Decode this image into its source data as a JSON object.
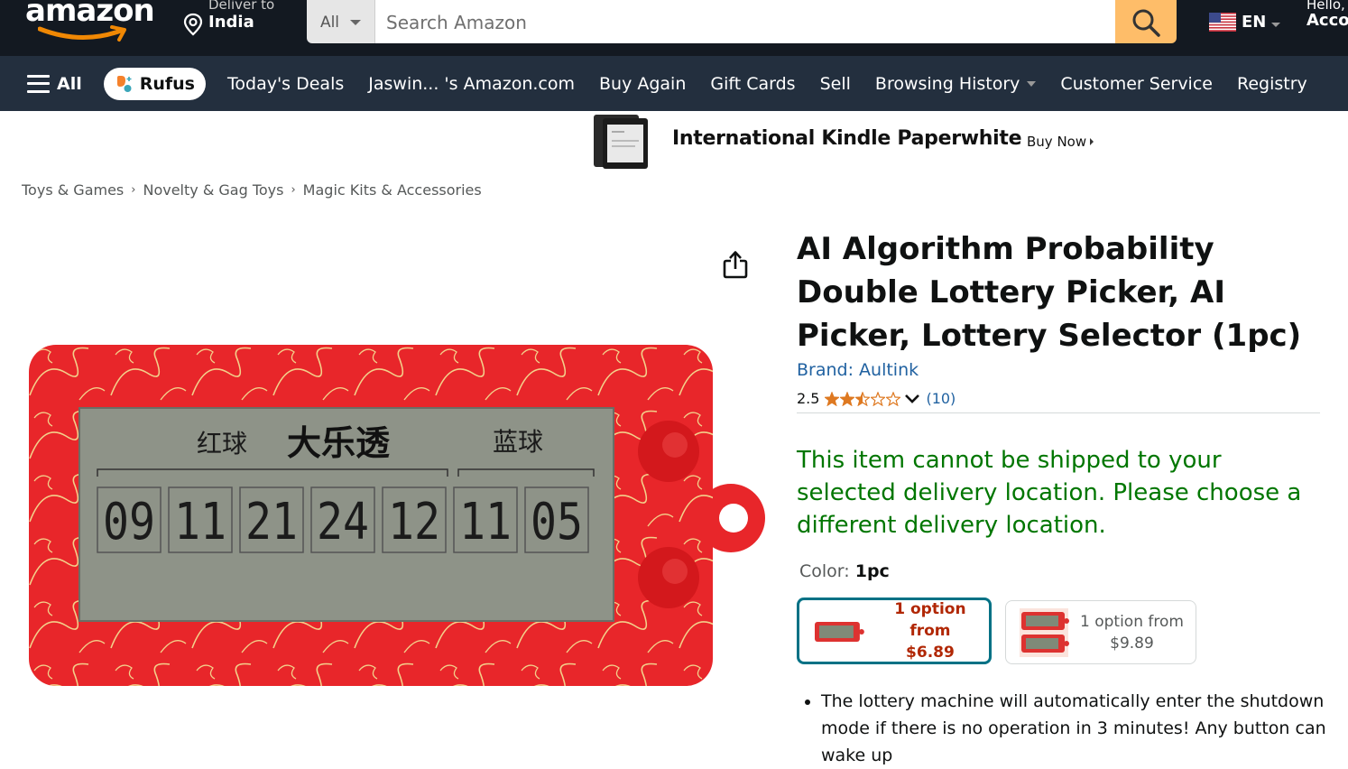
{
  "header": {
    "logo_text": "amazon",
    "deliver_label": "Deliver to",
    "deliver_location": "India",
    "search": {
      "category": "All",
      "placeholder": "Search Amazon",
      "value": ""
    },
    "language": "EN",
    "account_greeting": "Hello,",
    "account_label": "Acco"
  },
  "subnav": {
    "all_label": "All",
    "rufus_label": "Rufus",
    "links": [
      {
        "label": "Today's Deals"
      },
      {
        "label": "Jaswin... 's Amazon.com"
      },
      {
        "label": "Buy Again"
      },
      {
        "label": "Gift Cards"
      },
      {
        "label": "Sell"
      },
      {
        "label": "Browsing History",
        "has_dropdown": true
      },
      {
        "label": "Customer Service"
      },
      {
        "label": "Registry"
      }
    ]
  },
  "promo": {
    "title": "International Kindle Paperwhite",
    "cta": "Buy Now"
  },
  "breadcrumb": [
    "Toys & Games",
    "Novelty & Gag Toys",
    "Magic Kits & Accessories"
  ],
  "breadcrumb_separator": "›",
  "product": {
    "title": "AI Algorithm Probability Double Lottery Picker, AI Picker, Lottery Selector (1pc)",
    "brand": "Brand: Aultink",
    "rating_value": "2.5",
    "rating_stars": 2.5,
    "rating_max": 5,
    "rating_count": "(10)",
    "shipping_message": "This item cannot be shipped to your selected delivery location. Please choose a different delivery location.",
    "color_label": "Color:",
    "color_value": "1pc",
    "options": [
      {
        "line1": "1 option from",
        "price": "$6.89",
        "selected": true
      },
      {
        "line1": "1 option from",
        "price": "$9.89",
        "selected": false
      }
    ],
    "bullets": [
      "The lottery machine will automatically enter the shutdown mode if there is no operation in 3 minutes! Any button can wake up"
    ],
    "image": {
      "lcd_labels": [
        "红球",
        "大乐透",
        "蓝球"
      ],
      "lcd_numbers": [
        "09",
        "11",
        "21",
        "24",
        "12",
        "11",
        "05"
      ]
    }
  },
  "colors": {
    "nav_dark": "#131921",
    "nav_sub": "#232f3e",
    "search_button": "#febd69",
    "link_blue": "#2162a1",
    "ship_green": "#007600",
    "price_red": "#b12704",
    "selected_border": "#007185",
    "star_orange": "#de7921"
  }
}
